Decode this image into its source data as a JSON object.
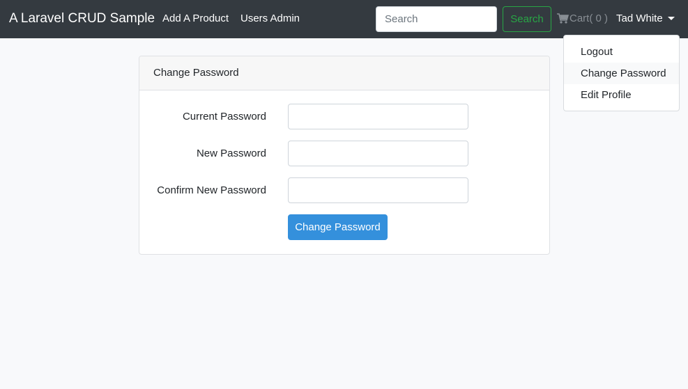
{
  "navbar": {
    "brand": "A Laravel CRUD Sample",
    "links": [
      {
        "label": "Add A Product"
      },
      {
        "label": "Users Admin"
      }
    ],
    "search": {
      "placeholder": "Search",
      "value": "",
      "button_label": "Search"
    },
    "cart": {
      "icon": "shopping-cart-icon",
      "label": "Cart( 0 )"
    },
    "user": {
      "name": "Tad White",
      "icon": "caret-down-icon"
    }
  },
  "user_menu": {
    "items": [
      {
        "label": "Logout",
        "active": false
      },
      {
        "label": "Change Password",
        "active": true
      },
      {
        "label": "Edit Profile",
        "active": false
      }
    ]
  },
  "card": {
    "title": "Change Password",
    "fields": [
      {
        "label": "Current Password",
        "value": ""
      },
      {
        "label": "New Password",
        "value": ""
      },
      {
        "label": "Confirm New Password",
        "value": ""
      }
    ],
    "submit_label": "Change Password"
  },
  "colors": {
    "navbar_bg": "#343a40",
    "success": "#28a745",
    "primary": "#3490dc",
    "page_bg": "#f8f9fb"
  }
}
